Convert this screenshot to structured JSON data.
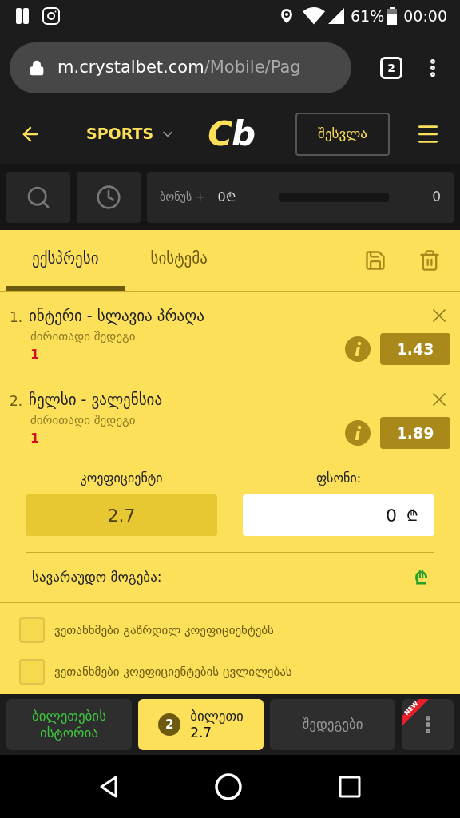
{
  "status_bar": {
    "battery": "61%",
    "time": "00:00"
  },
  "browser": {
    "url_host": "m.crystalbet.com",
    "url_path": "/Mobile/Pag",
    "tab_count": "2"
  },
  "header": {
    "section": "SPORTS",
    "logo": [
      "C",
      "b"
    ],
    "login": "შესვლა"
  },
  "toolbar": {
    "bonus_label": "ბონუს +",
    "bonus_value": "0₾",
    "bonus_count": "0"
  },
  "tabs": [
    {
      "label": "ექსპრესი",
      "selected": true
    },
    {
      "label": "სისტემა",
      "selected": false
    }
  ],
  "bets": [
    {
      "number": "1.",
      "match": "ინტერი - სლავია პრაღა",
      "market": "ძირითადი შედეგი",
      "pick": "1",
      "odds": "1.43"
    },
    {
      "number": "2.",
      "match": "ჩელსი - ვალენსია",
      "market": "ძირითადი შედეგი",
      "pick": "1",
      "odds": "1.89"
    }
  ],
  "totals": {
    "odds_label": "კოეფიციენტი",
    "odds_value": "2.7",
    "stake_label": "ფსონი:",
    "stake_value": "0",
    "currency": "₾",
    "win_label": "სავარაუდო მოგება:",
    "win_currency": "₾"
  },
  "options": [
    {
      "label": "ვეთანხმები გაზრდილ კოეფიციენტებს",
      "checked": false
    },
    {
      "label": "ვეთანხმები კოეფიციენტების ცვლილებას",
      "checked": false
    }
  ],
  "bottom_nav": [
    {
      "kind": "history",
      "label": "ბილეთების ისტორია",
      "selected": false
    },
    {
      "kind": "ticket",
      "label": "ბილეთი",
      "count": "2",
      "value": "2.7",
      "selected": true
    },
    {
      "kind": "results",
      "label": "შედეგები",
      "selected": false
    },
    {
      "kind": "more",
      "badge": "NEW",
      "selected": false
    }
  ]
}
